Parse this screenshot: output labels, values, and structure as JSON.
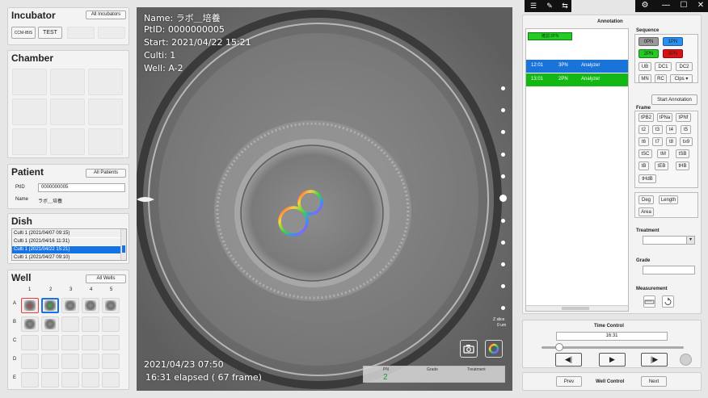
{
  "incubator": {
    "title": "Incubator",
    "all_button": "All Incubators",
    "items": [
      "CCM-IBIS",
      "TEST"
    ]
  },
  "chamber": {
    "title": "Chamber"
  },
  "patient": {
    "title": "Patient",
    "all_button": "All Patients",
    "ptid_label": "PtID",
    "ptid_value": "0000000005",
    "name_label": "Name",
    "name_value": "ラボ＿培養"
  },
  "dish": {
    "title": "Dish",
    "rows": [
      "Culti 1 (2021/04/07 09:15)",
      "Culti 1 (2021/04/16 11:31)",
      "Culti 1 (2021/04/22 15:21)",
      "Culti 1 (2021/04/27 09:10)"
    ],
    "selected_index": 2
  },
  "well": {
    "title": "Well",
    "all_button": "All Wells",
    "columns": [
      "1",
      "2",
      "3",
      "4",
      "5"
    ],
    "rows": [
      "A",
      "B",
      "C",
      "D",
      "E"
    ]
  },
  "viewer": {
    "name_line": "Name: ラボ＿培養",
    "ptid_line": "PtID: 0000000005",
    "start_line": "Start: 2021/04/22  15:21",
    "culti_line": "Culti: 1",
    "well_line": "Well: A-2",
    "timestamp": "2021/04/23  07:50",
    "elapsed": "16:31 elapsed ( 67 frame)",
    "zslice_label": "Z slice",
    "zslice_value": "0 um",
    "mini_header_pn": "PN",
    "mini_header_grade": "Grade",
    "mini_header_treatment": "Treatment",
    "mini_pn_value": "2"
  },
  "annotation": {
    "title": "Annotation",
    "tag": "確認:2PN",
    "rows": [
      {
        "time": "12:01",
        "label": "3PN",
        "by": "Analyzer",
        "color": "#1a73d9"
      },
      {
        "time": "13:01",
        "label": "2PN",
        "by": "Analyzer",
        "color": "#14b814"
      }
    ],
    "sequence_title": "Sequence",
    "seq_buttons": [
      {
        "label": "0PN",
        "color": "#9a9a9a"
      },
      {
        "label": "1PN",
        "color": "#2a8ff0"
      },
      {
        "label": "2PN",
        "color": "#22cc22"
      },
      {
        "label": "3PN",
        "color": "#dd1111"
      }
    ],
    "seq_small": [
      "UB",
      "DC1",
      "DC2",
      "MN",
      "RC",
      "Clps ▾"
    ],
    "start_button": "Start Annotation",
    "frame_title": "Frame",
    "frame_buttons": [
      "tPB2",
      "tPNa",
      "tPNf",
      "t2",
      "t3",
      "t4",
      "t5",
      "t6",
      "t7",
      "t8",
      "t≥9",
      "tSC",
      "tM",
      "tSB",
      "tB",
      "tEB",
      "tHB",
      "tHdB"
    ],
    "measure_small": [
      "Deg",
      "Length",
      "Area"
    ],
    "treatment_title": "Treatment",
    "grade_title": "Grade",
    "measurement_title": "Measurement"
  },
  "time_control": {
    "title": "Time Control",
    "value": "16:31",
    "slider_fraction": 0.04
  },
  "well_control": {
    "prev": "Prev",
    "title": "Well Control",
    "next": "Next"
  },
  "toolbar": {
    "tools": [
      "list-icon",
      "pen-icon",
      "arrows-icon"
    ],
    "settings": "gear-icon",
    "minimize": "—",
    "maximize": "☐",
    "close": "✕"
  }
}
